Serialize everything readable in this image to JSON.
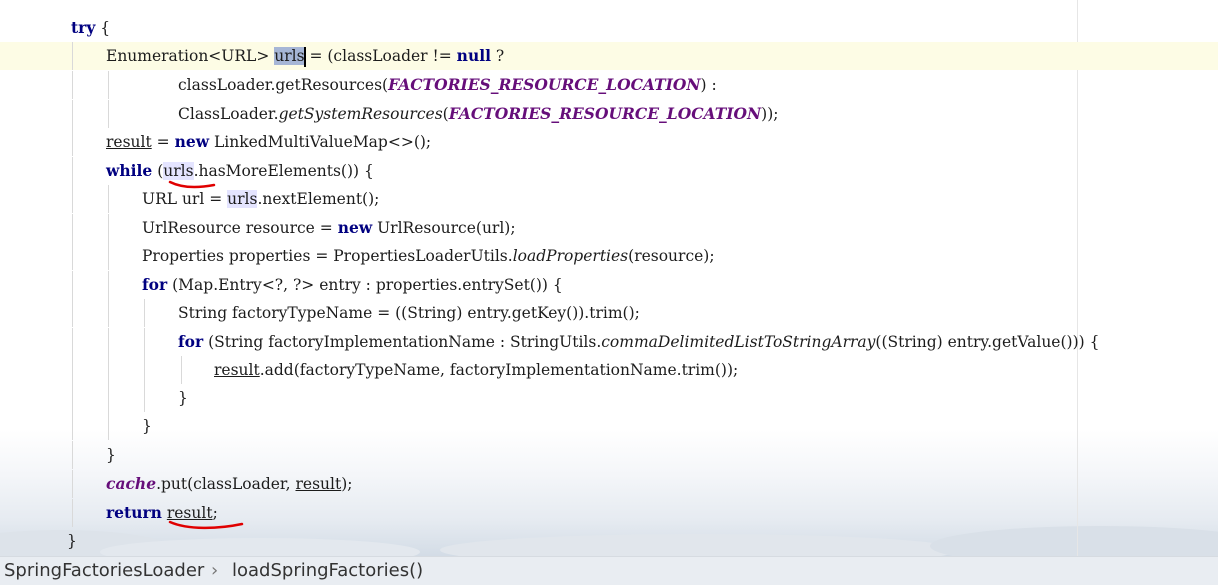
{
  "editor": {
    "lines": {
      "l1": {
        "kw_try": "try",
        "brace": " {"
      },
      "l2": {
        "p1": "Enumeration<URL> ",
        "sel": "urls",
        "p2": " = (classLoader != ",
        "kw_null": "null",
        "p3": " ?"
      },
      "l3": {
        "p1": "classLoader.getResources(",
        "c": "FACTORIES_RESOURCE_LOCATION",
        "p2": ") :"
      },
      "l4": {
        "p1": "ClassLoader.",
        "s": "getSystemResources",
        "p2": "(",
        "c": "FACTORIES_RESOURCE_LOCATION",
        "p3": "));"
      },
      "l5": {
        "u": "result",
        "p1": " = ",
        "kw_new": "new",
        "p2": " LinkedMultiValueMap<>();"
      },
      "l6": {
        "kw_while": "while",
        "p1": " (",
        "h": "urls",
        "p2": ".hasMoreElements()) {"
      },
      "l7": {
        "p1": "URL url = ",
        "h": "urls",
        "p2": ".nextElement();"
      },
      "l8": {
        "p1": "UrlResource resource = ",
        "kw_new": "new",
        "p2": " UrlResource(url);"
      },
      "l9": {
        "p1": "Properties properties = PropertiesLoaderUtils.",
        "s": "loadProperties",
        "p2": "(resource);"
      },
      "l10": {
        "kw_for": "for",
        "p1": " (Map.Entry<?, ?> entry : properties.entrySet()) {"
      },
      "l11": {
        "p1": "String factoryTypeName = ((String) entry.getKey()).trim();"
      },
      "l12": {
        "kw_for": "for",
        "p1": " (String factoryImplementationName : StringUtils.",
        "s": "commaDelimitedListToStringArray",
        "p2": "((String) entry.getValue())) {"
      },
      "l13": {
        "u": "result",
        "p1": ".add(factoryTypeName, factoryImplementationName.trim());"
      },
      "l14": {
        "p1": "}"
      },
      "l15": {
        "p1": "}"
      },
      "l16": {
        "p1": "}"
      },
      "l17": {
        "f": "cache",
        "p1": ".put(classLoader, ",
        "u": "result",
        "p2": ");"
      },
      "l18": {
        "kw_return": "return",
        "p1": " ",
        "u": "result",
        "p2": ";"
      },
      "l19": {
        "p1": "}"
      }
    }
  },
  "breadcrumb": {
    "class_name": "SpringFactoriesLoader",
    "separator": "›",
    "method_name": "loadSpringFactories()"
  },
  "colors": {
    "keyword": "#000080",
    "constant": "#660e7a",
    "selection": "#a6b6d6",
    "current_line": "#fdfce5",
    "red_annotation": "#e00000"
  }
}
